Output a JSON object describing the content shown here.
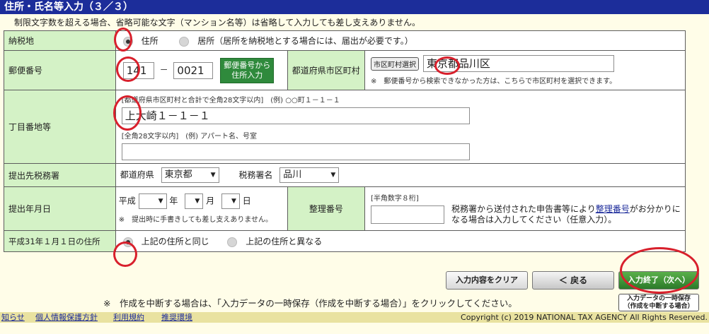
{
  "header": {
    "title": "住所・氏名等入力（３／３）"
  },
  "note": "制限文字数を超える場合、省略可能な文字（マンション名等）は省略して入力しても差し支えありません。",
  "rows": {
    "nouzeichi": {
      "label": "納税地",
      "opt1": "住所",
      "opt2": "居所（居所を納税地とする場合には、届出が必要です。）"
    },
    "postal": {
      "label": "郵便番号",
      "part1": "141",
      "dash": "－",
      "part2": "0021",
      "lookup_btn_line1": "郵便番号から",
      "lookup_btn_line2": "住所入力",
      "city_label": "都道府県市区町村",
      "select_btn": "市区町村選択",
      "city_value": "東京都品川区",
      "city_note": "※　郵便番号から検索できなかった方は、こちらで市区町村を選択できます。"
    },
    "chome": {
      "label": "丁目番地等",
      "hint1": "[都道府県市区町村と合計で全角28文字以内]　(例) ○○町１－１－１",
      "value1": "上大崎１－１－１",
      "hint2": "[全角28文字以内]　(例) アパート名、号室",
      "value2": ""
    },
    "office": {
      "label": "提出先税務署",
      "pref_label": "都道府県",
      "pref_value": "東京都",
      "office_label": "税務署名",
      "office_value": "品川"
    },
    "date": {
      "label": "提出年月日",
      "era": "平成",
      "year_unit": "年",
      "month_unit": "月",
      "day_unit": "日",
      "note": "※　提出時に手書きしても差し支えありません。",
      "seiri_label": "整理番号",
      "seiri_hint": "[半角数字８桁]",
      "seiri_text_pre": "税務署から送付された申告書等により",
      "seiri_link": "整理番号",
      "seiri_text_post": "がお分かりになる場合は入力してください（任意入力）。"
    },
    "h31": {
      "label": "平成31年１月１日の住所",
      "opt1": "上記の住所と同じ",
      "opt2": "上記の住所と異なる"
    }
  },
  "buttons": {
    "clear": "入力内容をクリア",
    "back": "＜ 戻る",
    "next": "入力終了（次へ）",
    "save_line1": "入力データの一時保存",
    "save_line2": "（作成を中断する場合）"
  },
  "bottom_note": "※　作成を中断する場合は、「入力データの一時保存（作成を中断する場合）」をクリックしてください。",
  "footer": {
    "link0": "知らせ",
    "link1": "個人情報保護方針",
    "link2": "利用規約",
    "link3": "推奨環境",
    "copyright": "Copyright (c) 2019 NATIONAL TAX AGENCY All Rights Reserved."
  },
  "colors": {
    "titlebar": "#1c2d9a",
    "label_bg": "#d4f2c6",
    "green_button": "#2f8a3c",
    "annotation": "#d8202c"
  }
}
